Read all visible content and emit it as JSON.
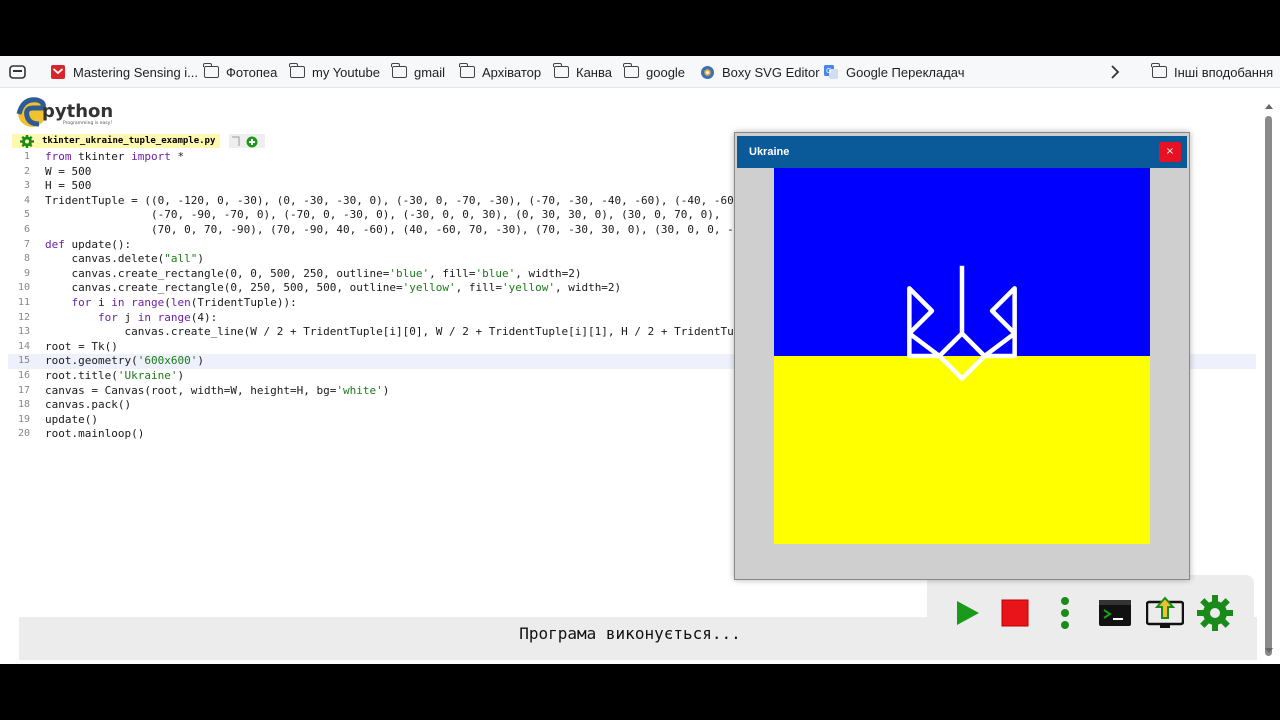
{
  "bookmarks": [
    {
      "label": "Mastering Sensing i...",
      "icon": "gmail-icon"
    },
    {
      "label": "Фотопеа",
      "icon": "folder-icon"
    },
    {
      "label": "my Youtube",
      "icon": "folder-icon"
    },
    {
      "label": "gmail",
      "icon": "folder-icon"
    },
    {
      "label": "Архіватор",
      "icon": "folder-icon"
    },
    {
      "label": "Канва",
      "icon": "folder-icon"
    },
    {
      "label": "google",
      "icon": "folder-icon"
    },
    {
      "label": "Boxy SVG Editor",
      "icon": "boxy-svg-icon"
    },
    {
      "label": "Google Перекладач",
      "icon": "google-translate-icon"
    }
  ],
  "bookmarks_other": "Інші вподобання",
  "logo": {
    "text": "python",
    "tagline": "Programming is easy!"
  },
  "editor": {
    "file_tab": "tkinter_ukraine_tuple_example.py",
    "active_line": 15,
    "lines": [
      "from tkinter import *",
      "W = 500",
      "H = 500",
      "TridentTuple = ((0, -120, 0, -30), (0, -30, -30, 0), (-30, 0, -70, -30), (-70, -30, -40, -60), (-40, -60",
      "                (-70, -90, -70, 0), (-70, 0, -30, 0), (-30, 0, 0, 30), (0, 30, 30, 0), (30, 0, 70, 0),",
      "                (70, 0, 70, -90), (70, -90, 40, -60), (40, -60, 70, -30), (70, -30, 30, 0), (30, 0, 0, -",
      "def update():",
      "    canvas.delete(\"all\")",
      "    canvas.create_rectangle(0, 0, 500, 250, outline='blue', fill='blue', width=2)",
      "    canvas.create_rectangle(0, 250, 500, 500, outline='yellow', fill='yellow', width=2)",
      "    for i in range(len(TridentTuple)):",
      "        for j in range(4):",
      "            canvas.create_line(W / 2 + TridentTuple[i][0], W / 2 + TridentTuple[i][1], H / 2 + TridentTup",
      "root = Tk()",
      "root.geometry('600x600')",
      "root.title('Ukraine')",
      "canvas = Canvas(root, width=W, height=H, bg='white')",
      "canvas.pack()",
      "update()",
      "root.mainloop()"
    ]
  },
  "output": {
    "text": "Програма виконується..."
  },
  "tk_window": {
    "title": "Ukraine",
    "close_glyph": "×",
    "flag_top_color": "#0000ff",
    "flag_bottom_color": "#ffff00"
  },
  "toolbar": [
    {
      "name": "run-icon",
      "color": "#1a9a1a"
    },
    {
      "name": "stop-icon",
      "color": "#e8141a"
    },
    {
      "name": "more-vertical-icon",
      "color": "#1a8a1a"
    },
    {
      "name": "terminal-icon",
      "color": "#111111"
    },
    {
      "name": "upload-icon",
      "color": "#1a8a1a"
    },
    {
      "name": "gear-icon",
      "color": "#1a8a1a"
    }
  ]
}
